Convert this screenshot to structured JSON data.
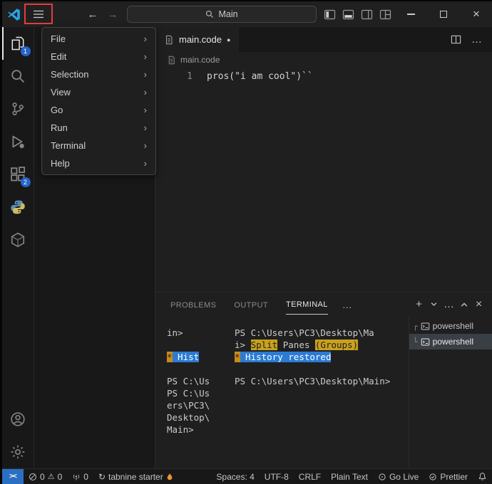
{
  "colors": {
    "remote_blue": "#2a6fc2",
    "selection_blue": "#2b7bd4",
    "find_match_yellow": "#c9a11c",
    "find_match_orange": "#c98a1c",
    "annotation_red": "#e23c3c",
    "badge_blue": "#2563c9"
  },
  "icons": {
    "back": "←",
    "forward": "→",
    "more": "…",
    "chevron_right": "›",
    "close": "×",
    "plus": "+",
    "warning": "⚠",
    "refresh": "↻",
    "modified_dot": "●",
    "remote": "><"
  },
  "titlebar": {
    "search_value": "Main"
  },
  "menu": {
    "items": [
      {
        "label": "File"
      },
      {
        "label": "Edit"
      },
      {
        "label": "Selection"
      },
      {
        "label": "View"
      },
      {
        "label": "Go"
      },
      {
        "label": "Run"
      },
      {
        "label": "Terminal"
      },
      {
        "label": "Help"
      }
    ]
  },
  "activity_bar": {
    "explorer_badge": "1",
    "extensions_badge": "2"
  },
  "editor": {
    "tab_label": "main.code",
    "breadcrumb": "main.code",
    "line_number": "1",
    "code_line": "pros(\"i am cool\")``"
  },
  "panel": {
    "tabs": [
      {
        "label": "PROBLEMS"
      },
      {
        "label": "OUTPUT"
      },
      {
        "label": "TERMINAL"
      }
    ]
  },
  "terminal": {
    "left_pane": {
      "line1": "in>",
      "match_star": "*",
      "match_text": " Hist",
      "line3": "PS C:\\Us",
      "line4": "PS C:\\Us",
      "line5": "ers\\PC3\\",
      "line6": "Desktop\\",
      "line7": "Main>"
    },
    "main_pane": {
      "line1": "PS C:\\Users\\PC3\\Desktop\\Ma",
      "line2_prefix": "i> ",
      "line2_match1": "Split",
      "line2_mid": " Panes ",
      "line2_match2": "(Groups)",
      "line3_star": "*",
      "line3_selection": " History restored",
      "line5": "PS C:\\Users\\PC3\\Desktop\\Main>"
    },
    "tabs": [
      {
        "branch": "┌",
        "label": "powershell"
      },
      {
        "branch": "└",
        "label": "powershell"
      }
    ]
  },
  "statusbar": {
    "errors": "0",
    "warnings": "0",
    "ports": "0",
    "tabnine_label": "tabnine starter",
    "indent": "Spaces: 4",
    "encoding": "UTF-8",
    "eol": "CRLF",
    "language": "Plain Text",
    "go_live": "Go Live",
    "prettier": "Prettier"
  }
}
